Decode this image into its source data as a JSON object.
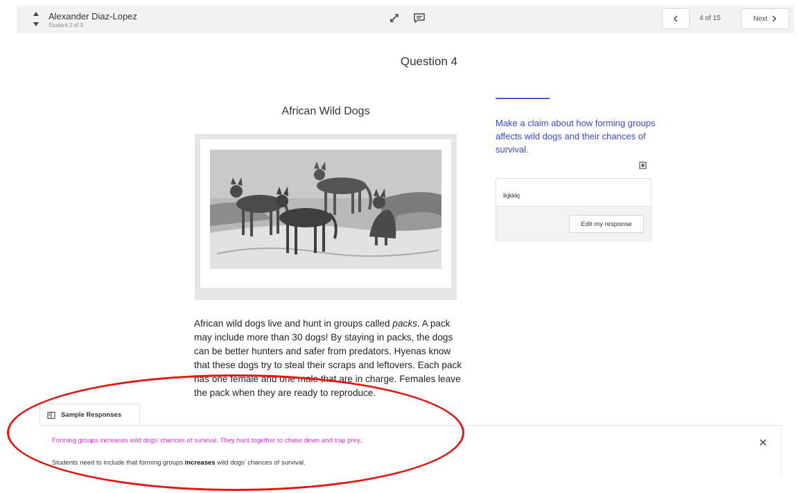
{
  "header": {
    "student_name": "Alexander Diaz-Lopez",
    "student_count": "Student 2 of 3",
    "page_info": "4 of 15",
    "next_label": "Next"
  },
  "question": {
    "title": "Question 4",
    "passage_title": "African Wild Dogs",
    "passage": {
      "p1": "African wild dogs live and hunt in groups called ",
      "p1_em": "packs",
      "p1_rest": ". A pack may include more than 30 dogs! By staying in packs, the dogs can be better hunters and safer from predators. Hyenas know that these dogs try to steal their scraps and leftovers. Each pack has one female and one male that are in charge. Females leave the pack when they are ready to reproduce."
    }
  },
  "prompt": {
    "text": "Make a claim about how forming groups affects wild dogs and their chances of survival.",
    "response": "lkjkkkj",
    "edit_label": "Edit my response"
  },
  "sample_responses": {
    "tab_label": "Sample Responses",
    "sample": "Forming groups increases wild dogs' chances of survival. They hunt together to chase down and trap prey.",
    "note_before": "Students need to include that forming groups ",
    "note_bold": "increases",
    "note_after": " wild dogs' chances of survival."
  },
  "colors": {
    "prompt_blue": "#3a4ac9",
    "sample_magenta": "#e430e4",
    "annotation_red": "#e81414"
  },
  "icons": {
    "student_up": "caret-up-icon",
    "student_down": "caret-down-icon",
    "expand": "expand-icon",
    "comment": "comment-icon",
    "prev": "chevron-left-icon",
    "next": "chevron-right-icon",
    "book": "book-icon",
    "close": "close-icon"
  }
}
